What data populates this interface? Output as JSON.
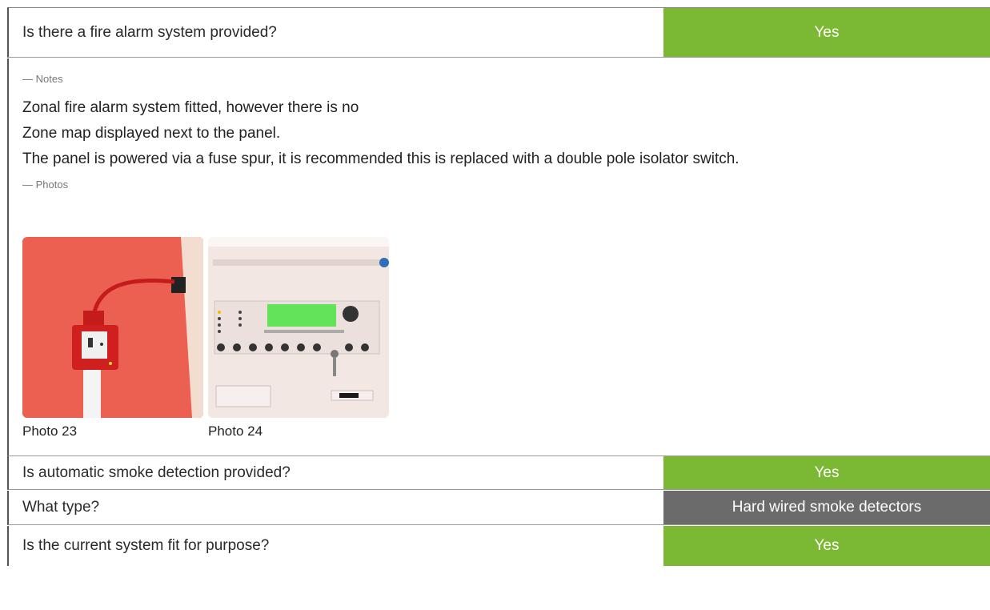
{
  "questions": [
    {
      "question": "Is there a fire alarm system provided?",
      "answer": "Yes",
      "color": "#7bb934"
    },
    {
      "question": "Is automatic smoke detection provided?",
      "answer": "Yes",
      "color": "#7bb934"
    },
    {
      "question": "What type?",
      "answer": "Hard wired smoke detectors",
      "color": "#6b6b6b"
    },
    {
      "question": "Is the current system fit for purpose?",
      "answer": "Yes",
      "color": "#7bb934"
    }
  ],
  "notes": {
    "label": "— Notes",
    "lines": [
      "Zonal fire alarm system fitted, however there is no",
      "Zone map displayed next to the panel.",
      "The panel is powered via a fuse spur, it is recommended this is replaced with a double pole isolator switch."
    ]
  },
  "photos": {
    "label": "— Photos",
    "items": [
      {
        "caption": "Photo 23",
        "subject": "fused-spur-on-red-wall"
      },
      {
        "caption": "Photo 24",
        "subject": "fire-alarm-control-panel"
      }
    ]
  }
}
